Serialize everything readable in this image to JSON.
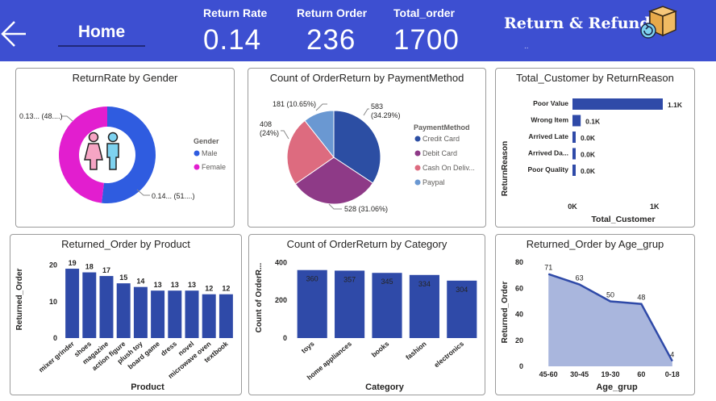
{
  "header": {
    "home_label": "Home",
    "title": "Return & Refund",
    "subtitle": "..",
    "kpis": [
      {
        "label": "Return Rate",
        "value": "0.14"
      },
      {
        "label": "Return Order",
        "value": "236"
      },
      {
        "label": "Total_order",
        "value": "1700"
      }
    ],
    "colors": {
      "header_bg": "#3d4fd1",
      "primary": "#2f4aa8",
      "male": "#2f5ce0",
      "female": "#e21ecf"
    }
  },
  "chart_data": [
    {
      "id": "gender",
      "type": "pie",
      "title": "ReturnRate by Gender",
      "legend_title": "Gender",
      "legend_position": "right",
      "categories": [
        "Male",
        "Female"
      ],
      "values": [
        0.14,
        0.13
      ],
      "colors": [
        "#2f5ce0",
        "#e21ecf"
      ],
      "data_labels": [
        "0.14... (51....)",
        "0.13... (48....)"
      ]
    },
    {
      "id": "payment",
      "type": "pie",
      "title": "Count of OrderReturn by PaymentMethod",
      "legend_title": "PaymentMethod",
      "legend_position": "right",
      "categories": [
        "Credit Card",
        "Debit Card",
        "Cash On Deliv...",
        "Paypal"
      ],
      "values": [
        583,
        528,
        408,
        181
      ],
      "colors": [
        "#2c4ea3",
        "#8e3a87",
        "#dd6b7f",
        "#6a98d2"
      ],
      "data_labels": [
        "583 (34.29%)",
        "528 (31.06%)",
        "408 (24%)",
        "181 (10.65%)"
      ]
    },
    {
      "id": "reason",
      "type": "bar",
      "orientation": "horizontal",
      "title": "Total_Customer by ReturnReason",
      "xlabel": "Total_Customer",
      "ylabel": "ReturnReason",
      "categories": [
        "Poor Value",
        "Wrong Item",
        "Arrived Late",
        "Arrived Da...",
        "Poor Quality"
      ],
      "values": [
        1100,
        100,
        0,
        0,
        0
      ],
      "data_labels": [
        "1.1K",
        "0.1K",
        "0.0K",
        "0.0K",
        "0.0K"
      ],
      "xlim": [
        0,
        1100
      ],
      "xticks": [
        "0K",
        "1K"
      ]
    },
    {
      "id": "product",
      "type": "bar",
      "title": "Returned_Order by Product",
      "xlabel": "Product",
      "ylabel": "Returned_Order",
      "categories": [
        "mixer grinder",
        "shoes",
        "magazine",
        "action figure",
        "plush toy",
        "board game",
        "dress",
        "novel",
        "microwave oven",
        "textbook"
      ],
      "values": [
        19,
        18,
        17,
        15,
        14,
        13,
        13,
        13,
        12,
        12
      ],
      "ylim": [
        0,
        21
      ],
      "yticks": [
        0,
        10,
        20
      ]
    },
    {
      "id": "category",
      "type": "bar",
      "title": "Count of OrderReturn by Category",
      "xlabel": "Category",
      "ylabel": "Count of OrderR...",
      "categories": [
        "toys",
        "home appliances",
        "books",
        "fashion",
        "electronics"
      ],
      "values": [
        360,
        357,
        345,
        334,
        304
      ],
      "ylim": [
        0,
        410
      ],
      "yticks": [
        0,
        200,
        400
      ]
    },
    {
      "id": "age",
      "type": "area",
      "title": "Returned_Order by Age_grup",
      "xlabel": "Age_grup",
      "ylabel": "Returned_Order",
      "categories": [
        "45-60",
        "30-45",
        "19-30",
        "60",
        "0-18"
      ],
      "values": [
        71,
        63,
        50,
        48,
        4
      ],
      "ylim": [
        0,
        82
      ],
      "yticks": [
        0,
        20,
        40,
        60,
        80
      ]
    }
  ]
}
